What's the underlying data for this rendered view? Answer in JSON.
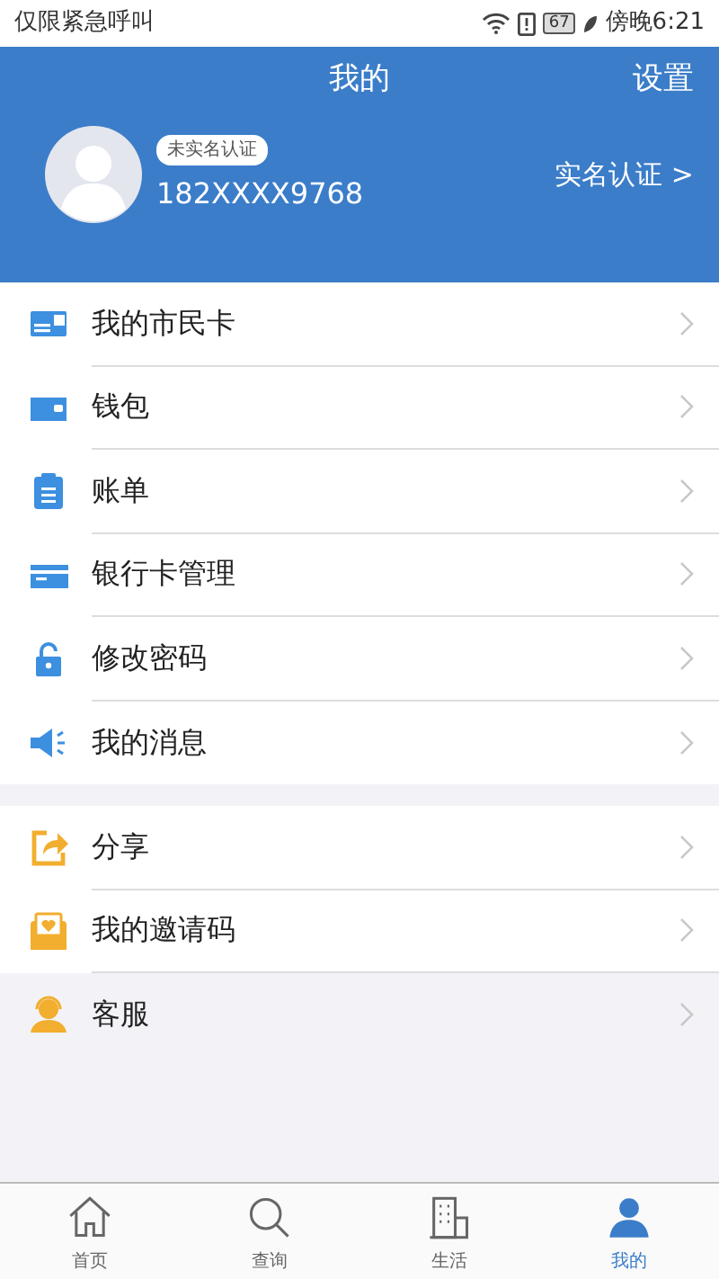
{
  "status_bar": {
    "carrier": "仅限紧急呼叫",
    "battery": "67",
    "time": "傍晚6:21"
  },
  "header": {
    "title": "我的",
    "action": "设置"
  },
  "profile": {
    "badge": "未实名认证",
    "phone": "182XXXX9768",
    "verify_link": "实名认证 >"
  },
  "groups": [
    {
      "items": [
        {
          "label": "我的市民卡",
          "selected": false
        },
        {
          "label": "钱包",
          "selected": false
        },
        {
          "label": "账单",
          "selected": false
        },
        {
          "label": "银行卡管理",
          "selected": false
        },
        {
          "label": "修改密码",
          "selected": false
        },
        {
          "label": "我的消息",
          "selected": false
        }
      ]
    },
    {
      "items": [
        {
          "label": "分享",
          "selected": false
        },
        {
          "label": "我的邀请码",
          "selected": false
        },
        {
          "label": "客服",
          "selected": true
        }
      ]
    }
  ],
  "tabs": [
    {
      "label": "首页",
      "selected": false
    },
    {
      "label": "查询",
      "selected": false
    },
    {
      "label": "生活",
      "selected": false
    },
    {
      "label": "我的",
      "selected": true
    }
  ]
}
